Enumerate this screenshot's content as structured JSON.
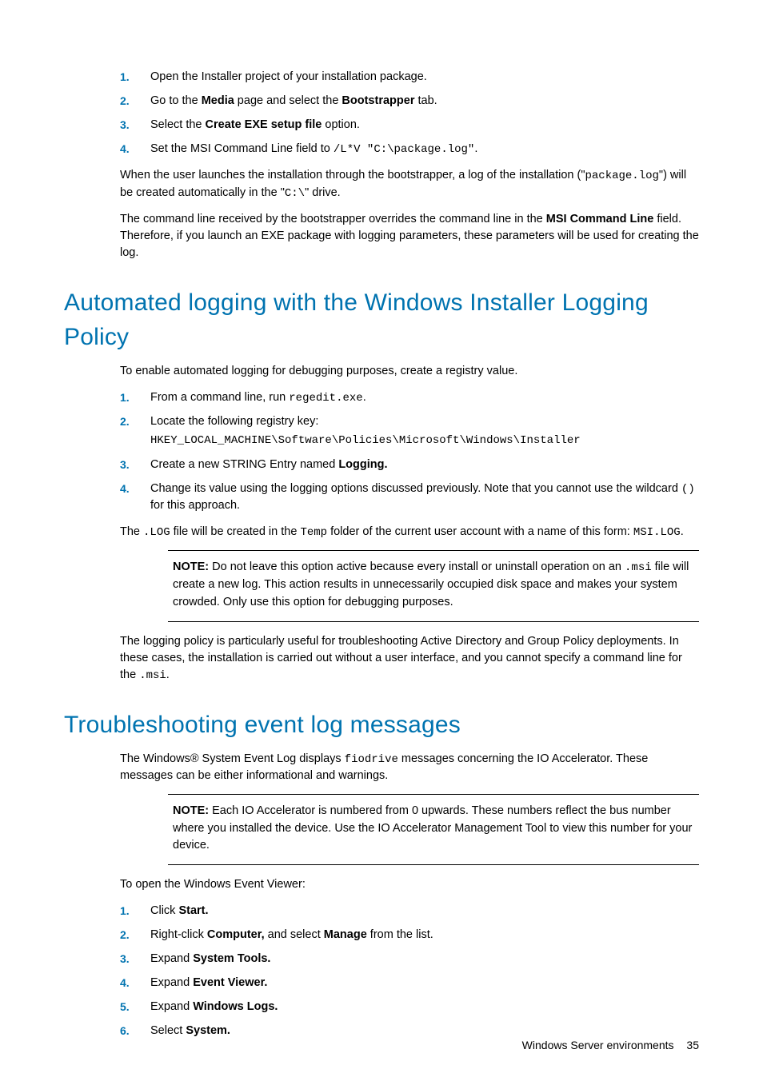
{
  "list1": {
    "items": [
      {
        "t": "Open the Installer project of your installation package."
      },
      {
        "prefix": "Go to the ",
        "b1": "Media",
        "mid": " page and select the ",
        "b2": "Bootstrapper",
        "suffix": " tab."
      },
      {
        "prefix": "Select the ",
        "b1": "Create EXE setup file",
        "suffix": " option."
      },
      {
        "prefix": "Set the MSI Command Line field to ",
        "code": "/L*V \"C:\\package.log\"",
        "suffix": "."
      }
    ]
  },
  "p_bootstrap1_a": "When the user launches the installation through the bootstrapper, a log of the installation (\"",
  "p_bootstrap1_code1": "package.log",
  "p_bootstrap1_b": "\") will be created automatically in the \"",
  "p_bootstrap1_code2": "C:\\",
  "p_bootstrap1_c": "\" drive.",
  "p_bootstrap2_a": "The command line received by the bootstrapper overrides the command line in the ",
  "p_bootstrap2_b": "MSI Command Line",
  "p_bootstrap2_c": " field. Therefore, if you launch an EXE package with logging parameters, these parameters will be used for creating the log.",
  "h_autolog": "Automated logging with the Windows Installer Logging Policy",
  "p_autolog_intro": "To enable automated logging for debugging purposes, create a registry value.",
  "list2": {
    "i1_a": "From a command line, run ",
    "i1_code": "regedit.exe",
    "i1_b": ".",
    "i2_a": "Locate the following registry key:",
    "i2_code": "HKEY_LOCAL_MACHINE\\Software\\Policies\\Microsoft\\Windows\\Installer",
    "i3_a": "Create a new STRING Entry named ",
    "i3_b": "Logging.",
    "i4_a": "Change its value using the logging options discussed previously. Note that you cannot use the wildcard ",
    "i4_code": "()",
    "i4_b": " for this approach."
  },
  "p_logcreated_a": "The ",
  "p_logcreated_code1": ".LOG",
  "p_logcreated_b": " file will be created in the ",
  "p_logcreated_code2": "Temp",
  "p_logcreated_c": " folder of the current user account with a name of this form: ",
  "p_logcreated_code3": "MSI.LOG",
  "p_logcreated_d": ".",
  "note1_label": "NOTE:",
  "note1_a": " Do not leave this option active because every install or uninstall operation on an ",
  "note1_code": ".msi",
  "note1_b": " file will create a new log. This action results in unnecessarily occupied disk space and makes your system crowded. Only use this option for debugging purposes.",
  "p_policy_a": "The logging policy is particularly useful for troubleshooting Active Directory and Group Policy deployments. In these cases, the installation is carried out without a user interface, and you cannot specify a command line for the ",
  "p_policy_code": ".msi",
  "p_policy_b": ".",
  "h_trouble": "Troubleshooting event log messages",
  "p_trouble_a": "The Windows® System Event Log displays ",
  "p_trouble_code": "fiodrive",
  "p_trouble_b": " messages concerning the IO Accelerator. These messages can be either informational and warnings.",
  "note2_label": "NOTE:",
  "note2_body": " Each IO Accelerator is numbered from 0 upwards. These numbers reflect the bus number where you installed the device. Use the IO Accelerator Management Tool to view this number for your device.",
  "p_openviewer": "To open the Windows Event Viewer:",
  "list3": {
    "i1_a": "Click ",
    "i1_b": "Start.",
    "i2_a": "Right-click ",
    "i2_b": "Computer,",
    "i2_c": " and select ",
    "i2_d": "Manage",
    "i2_e": " from the list.",
    "i3_a": "Expand ",
    "i3_b": "System Tools.",
    "i4_a": "Expand ",
    "i4_b": "Event Viewer.",
    "i5_a": "Expand ",
    "i5_b": "Windows Logs.",
    "i6_a": "Select ",
    "i6_b": "System."
  },
  "footer_text": "Windows Server environments",
  "footer_page": "35"
}
